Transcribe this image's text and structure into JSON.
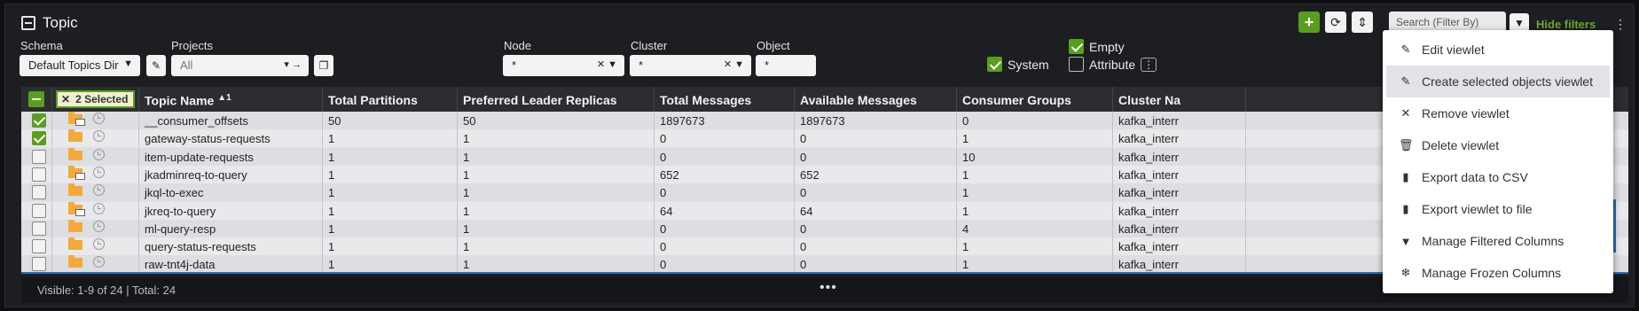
{
  "panel": {
    "title": "Topic"
  },
  "toolbar": {
    "add_label": "+",
    "search_placeholder": "Search (Filter By)",
    "hide_filters": "Hide filters",
    "more_label": "⋮"
  },
  "filters": {
    "schema": {
      "label": "Schema",
      "value": "Default Topics Dir"
    },
    "projects": {
      "label": "Projects",
      "value": "All"
    },
    "node": {
      "label": "Node",
      "value": "*"
    },
    "cluster": {
      "label": "Cluster",
      "value": "*"
    },
    "object": {
      "label": "Object",
      "value": "*"
    },
    "system": {
      "label": "System",
      "checked": true
    },
    "empty": {
      "label": "Empty",
      "checked": true
    },
    "attribute": {
      "label": "Attribute",
      "checked": false
    }
  },
  "grid": {
    "selected_badge": "2 Selected",
    "columns": [
      "Topic Name",
      "Total Partitions",
      "Preferred Leader Replicas",
      "Total Messages",
      "Available Messages",
      "Consumer Groups",
      "Cluster Na"
    ],
    "sort_indicator": "▲1",
    "rows": [
      {
        "checked": true,
        "mail": true,
        "cells": [
          "__consumer_offsets",
          "50",
          "50",
          "1897673",
          "1897673",
          "0",
          "kafka_interr"
        ]
      },
      {
        "checked": true,
        "mail": false,
        "cells": [
          "gateway-status-requests",
          "1",
          "1",
          "0",
          "0",
          "1",
          "kafka_interr"
        ]
      },
      {
        "checked": false,
        "mail": false,
        "cells": [
          "item-update-requests",
          "1",
          "1",
          "0",
          "0",
          "10",
          "kafka_interr"
        ]
      },
      {
        "checked": false,
        "mail": true,
        "cells": [
          "jkadminreq-to-query",
          "1",
          "1",
          "652",
          "652",
          "1",
          "kafka_interr"
        ]
      },
      {
        "checked": false,
        "mail": false,
        "cells": [
          "jkql-to-exec",
          "1",
          "1",
          "0",
          "0",
          "1",
          "kafka_interr"
        ]
      },
      {
        "checked": false,
        "mail": true,
        "cells": [
          "jkreq-to-query",
          "1",
          "1",
          "64",
          "64",
          "1",
          "kafka_interr"
        ]
      },
      {
        "checked": false,
        "mail": false,
        "cells": [
          "ml-query-resp",
          "1",
          "1",
          "0",
          "0",
          "4",
          "kafka_interr"
        ]
      },
      {
        "checked": false,
        "mail": false,
        "cells": [
          "query-status-requests",
          "1",
          "1",
          "0",
          "0",
          "1",
          "kafka_interr"
        ]
      },
      {
        "checked": false,
        "mail": false,
        "cells": [
          "raw-tnt4j-data",
          "1",
          "1",
          "0",
          "0",
          "1",
          "kafka_interr"
        ]
      }
    ]
  },
  "footer": {
    "status": "Visible: 1-9 of 24 | Total: 24",
    "dots": "•••"
  },
  "menu": {
    "items": [
      {
        "label": "Edit viewlet",
        "icon": "✎",
        "highlighted": false
      },
      {
        "label": "Create selected objects viewlet",
        "icon": "✎",
        "highlighted": true
      },
      {
        "label": "Remove viewlet",
        "icon": "✕",
        "highlighted": false
      },
      {
        "label": "Delete viewlet",
        "icon": "🗑",
        "highlighted": false
      },
      {
        "label": "Export data to CSV",
        "icon": "▮",
        "highlighted": false
      },
      {
        "label": "Export viewlet to file",
        "icon": "▮",
        "highlighted": false
      },
      {
        "label": "Manage Filtered Columns",
        "icon": "▼",
        "highlighted": false
      },
      {
        "label": "Manage Frozen Columns",
        "icon": "❄",
        "highlighted": false
      }
    ]
  },
  "colors": {
    "accent": "#5a9e1f",
    "highlight_bar": "#2e6db4",
    "folder": "#f3a93b"
  }
}
